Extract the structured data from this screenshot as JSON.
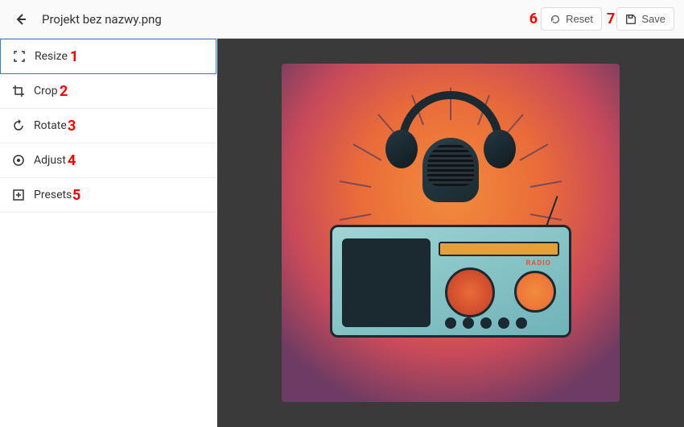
{
  "header": {
    "filename": "Projekt bez nazwy.png",
    "reset_label": "Reset",
    "save_label": "Save"
  },
  "tools": [
    {
      "label": "Resize",
      "icon": "resize-icon",
      "active": true
    },
    {
      "label": "Crop",
      "icon": "crop-icon",
      "active": false
    },
    {
      "label": "Rotate",
      "icon": "rotate-icon",
      "active": false
    },
    {
      "label": "Adjust",
      "icon": "adjust-icon",
      "active": false
    },
    {
      "label": "Presets",
      "icon": "presets-icon",
      "active": false
    }
  ],
  "annotations": {
    "resize": "1",
    "crop": "2",
    "rotate": "3",
    "adjust": "4",
    "presets": "5",
    "reset": "6",
    "save": "7"
  },
  "canvas": {
    "image_description": "Illustration of vintage radio with microphone and headphones",
    "radio_label": "RADIO"
  }
}
